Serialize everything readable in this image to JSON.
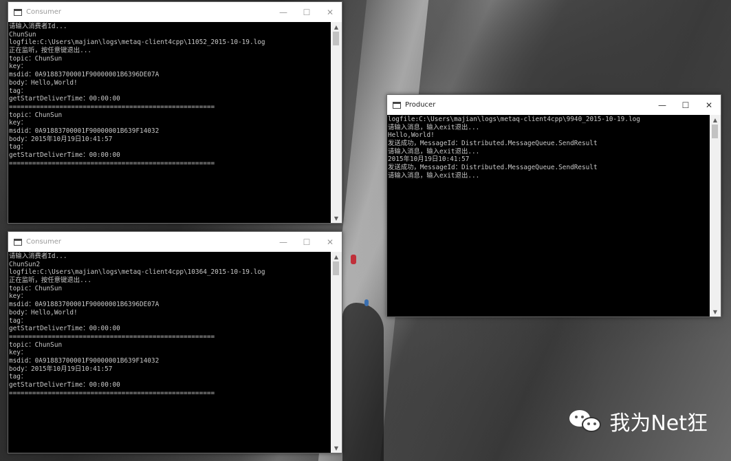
{
  "windows": {
    "consumer1": {
      "title": "Consumer",
      "lines": [
        "请输入消费者Id...",
        "ChunSun",
        "logfile:C:\\Users\\majian\\logs\\metaq-client4cpp\\11052_2015-10-19.log",
        "正在监听，按任意键退出...",
        "topic：ChunSun",
        "key：",
        "msdid：0A91883700001F90000001B6396DE07A",
        "body：Hello,World!",
        "tag：",
        "getStartDeliverTime：00:00:00",
        "=====================================================",
        "topic：ChunSun",
        "key：",
        "msdid：0A91883700001F90000001B639F14032",
        "body：2015年10月19日10:41:57",
        "tag：",
        "getStartDeliverTime：00:00:00",
        "====================================================="
      ]
    },
    "consumer2": {
      "title": "Consumer",
      "lines": [
        "请输入消费者Id...",
        "ChunSun2",
        "logfile:C:\\Users\\majian\\logs\\metaq-client4cpp\\10364_2015-10-19.log",
        "正在监听，按任意键退出...",
        "topic：ChunSun",
        "key：",
        "msdid：0A91883700001F90000001B6396DE07A",
        "body：Hello,World!",
        "tag：",
        "getStartDeliverTime：00:00:00",
        "=====================================================",
        "topic：ChunSun",
        "key：",
        "msdid：0A91883700001F90000001B639F14032",
        "body：2015年10月19日10:41:57",
        "tag：",
        "getStartDeliverTime：00:00:00",
        "====================================================="
      ]
    },
    "producer": {
      "title": "Producer",
      "lines": [
        "logfile:C:\\Users\\majian\\logs\\metaq-client4cpp\\9940_2015-10-19.log",
        "请输入消息，输入exit退出...",
        "Hello,World!",
        "发送成功，MessageId：Distributed.MessageQueue.SendResult",
        "请输入消息，输入exit退出...",
        "2015年10月19日10:41:57",
        "发送成功，MessageId：Distributed.MessageQueue.SendResult",
        "请输入消息，输入exit退出..."
      ]
    }
  },
  "controls": {
    "minimize": "—",
    "maximize": "☐",
    "close": "✕",
    "scroll_up": "▲",
    "scroll_down": "▼"
  },
  "watermark": {
    "text": "我为Net狂"
  }
}
